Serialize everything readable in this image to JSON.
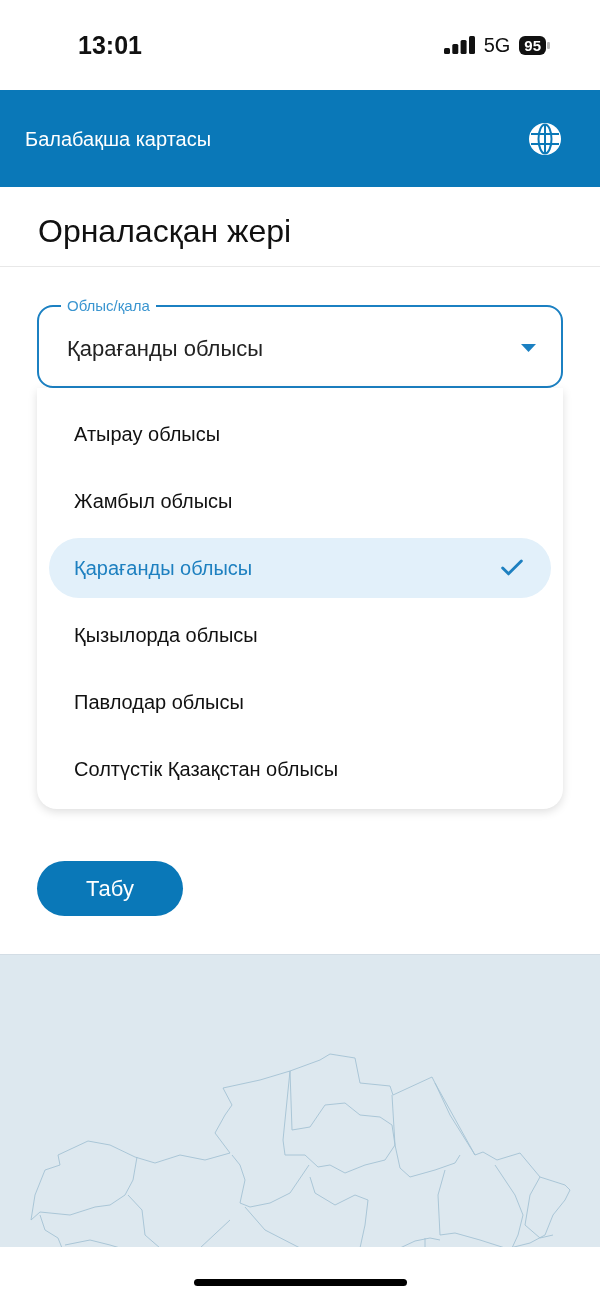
{
  "status_bar": {
    "time": "13:01",
    "network": "5G",
    "battery": "95"
  },
  "app_bar": {
    "title": "Балабақша картасы"
  },
  "page": {
    "title": "Орналасқан жері"
  },
  "region_select": {
    "label": "Облыс/қала",
    "value": "Қарағанды облысы",
    "expanded": true,
    "options": [
      {
        "label": "Атырау облысы",
        "selected": false
      },
      {
        "label": "Жамбыл облысы",
        "selected": false
      },
      {
        "label": "Қарағанды облысы",
        "selected": true
      },
      {
        "label": "Қызылорда облысы",
        "selected": false
      },
      {
        "label": "Павлодар облысы",
        "selected": false
      },
      {
        "label": "Солтүстік Қазақстан облысы",
        "selected": false
      }
    ]
  },
  "search_button": {
    "label": "Табу"
  }
}
